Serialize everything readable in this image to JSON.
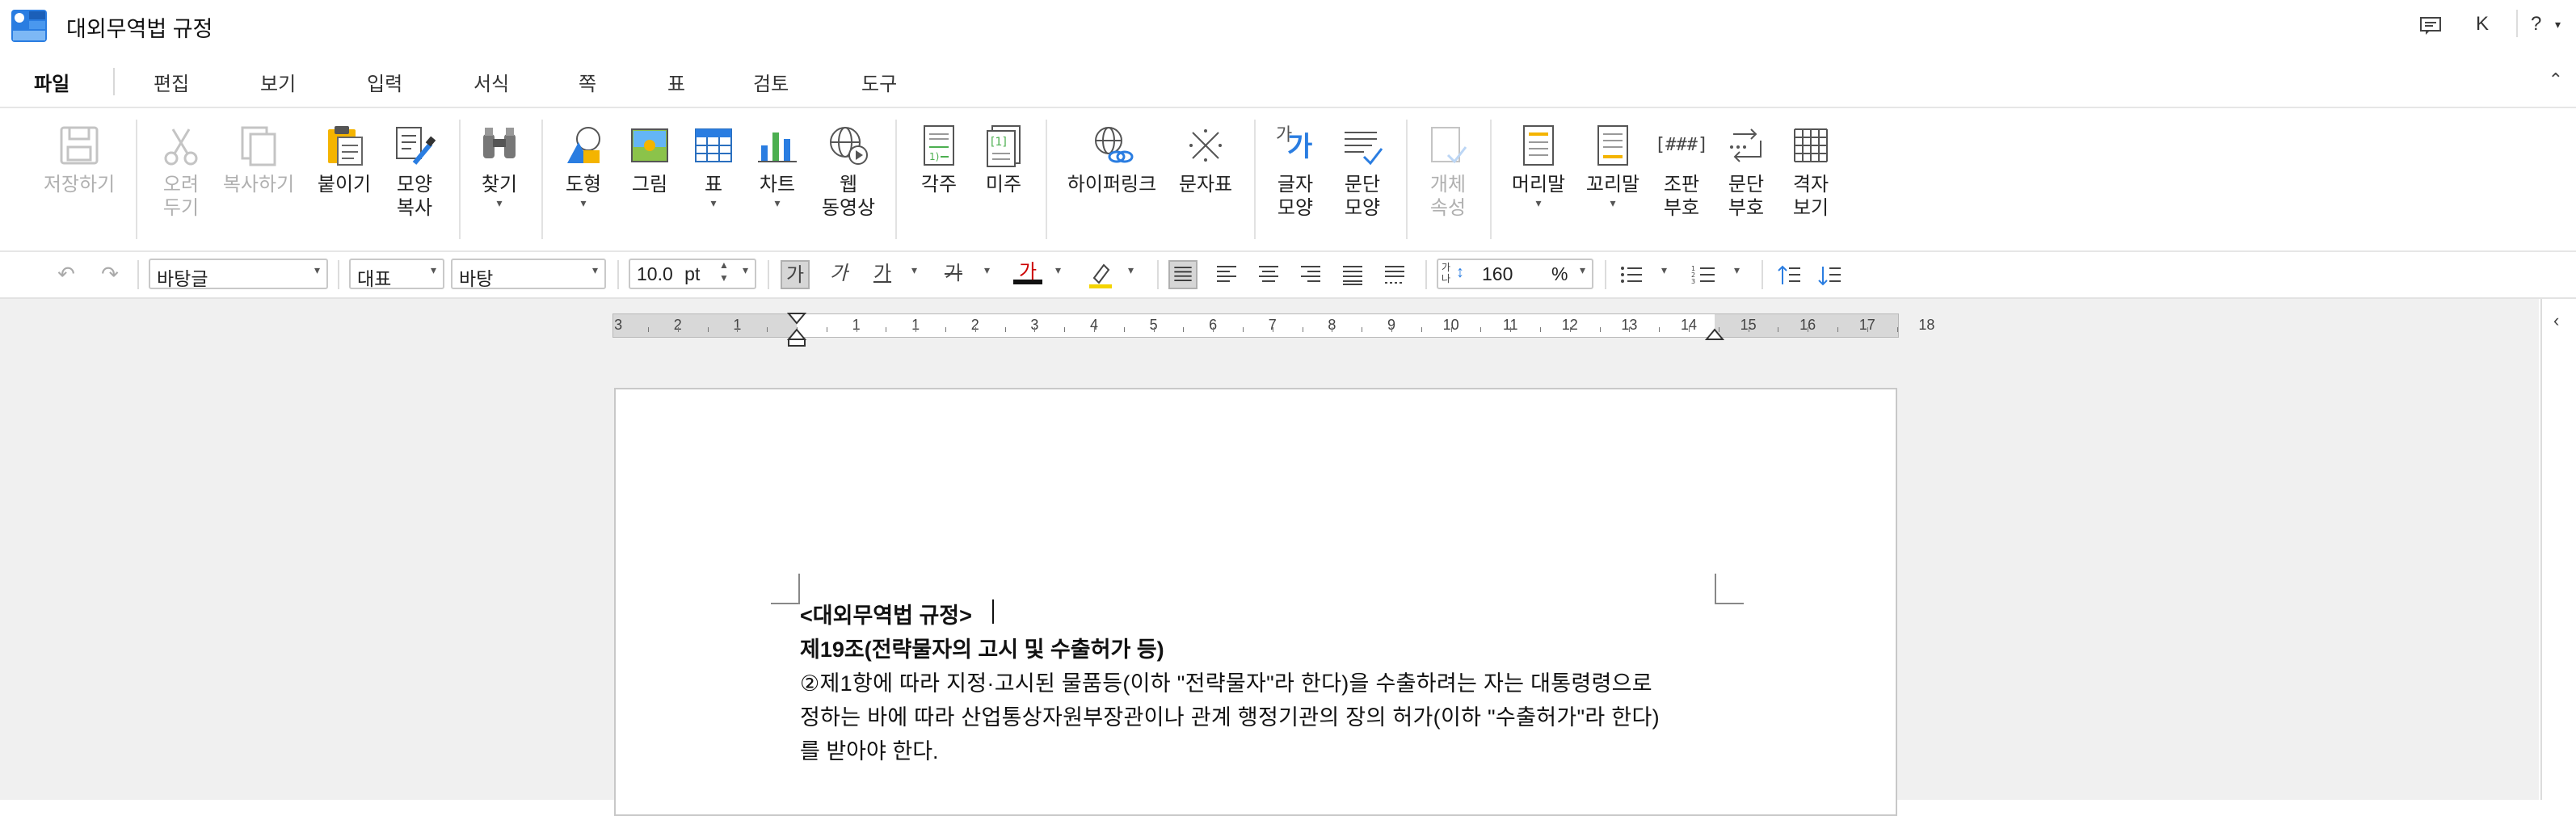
{
  "window": {
    "title": "대외무역법 규정",
    "user_initial": "K",
    "help_label": "?"
  },
  "menu": {
    "items": [
      "파일",
      "편집",
      "보기",
      "입력",
      "서식",
      "쪽",
      "표",
      "검토",
      "도구"
    ],
    "active": "파일"
  },
  "ribbon": {
    "save": [
      "저장하기"
    ],
    "cut": [
      "오려",
      "두기"
    ],
    "copy": [
      "복사하기"
    ],
    "paste": [
      "붙이기"
    ],
    "format_copy": [
      "모양",
      "복사"
    ],
    "find": [
      "찾기"
    ],
    "shape": [
      "도형"
    ],
    "picture": [
      "그림"
    ],
    "table": [
      "표"
    ],
    "chart": [
      "차트"
    ],
    "web_video": [
      "웹",
      "동영상"
    ],
    "footnote": [
      "각주"
    ],
    "endnote": [
      "미주"
    ],
    "hyperlink": [
      "하이퍼링크"
    ],
    "char_map": [
      "문자표"
    ],
    "char_shape": [
      "글자",
      "모양"
    ],
    "para_shape": [
      "문단",
      "모양"
    ],
    "object_props": [
      "개체",
      "속성"
    ],
    "header": [
      "머리말"
    ],
    "footer": [
      "꼬리말"
    ],
    "field_code": [
      "조판",
      "부호"
    ],
    "para_mark": [
      "문단",
      "부호"
    ],
    "grid_view": [
      "격자",
      "보기"
    ],
    "char_shape_icon_top": "가",
    "char_shape_icon_bottom": "가",
    "field_code_icon": "[###]"
  },
  "format": {
    "style": "바탕글",
    "lang": "대표",
    "font": "바탕",
    "size": "10.0",
    "size_unit": "pt",
    "bold_glyph": "가",
    "italic_glyph": "가",
    "underline_glyph": "가",
    "strike_glyph": "가",
    "color_glyph": "가",
    "line_spacing": "160",
    "line_spacing_unit": "%",
    "line_spacing_icon": "가나"
  },
  "ruler": {
    "labels": [
      "3",
      "2",
      "1",
      "1",
      "1",
      "2",
      "3",
      "4",
      "5",
      "6",
      "7",
      "8",
      "9",
      "10",
      "11",
      "12",
      "13",
      "14",
      "15",
      "16",
      "17",
      "18"
    ]
  },
  "document": {
    "lines": [
      "<대외무역법 규정>",
      "제19조(전략물자의 고시 및 수출허가 등)",
      "②제1항에 따라 지정·고시된 물품등(이하 \"전략물자\"라 한다)을 수출하려는 자는 대통령령으로",
      "정하는 바에 따라 산업통상자원부장관이나 관계 행정기관의 장의 허가(이하 \"수출허가\"라 한다)",
      "를 받아야 한다."
    ]
  }
}
